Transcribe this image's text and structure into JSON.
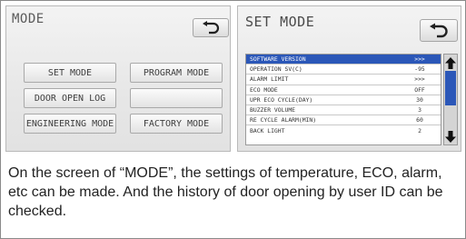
{
  "mode_screen": {
    "title": "MODE",
    "back_icon": "return-arrow-icon",
    "buttons": [
      {
        "label": "SET MODE"
      },
      {
        "label": "PROGRAM MODE"
      },
      {
        "label": "DOOR OPEN LOG"
      },
      {
        "label": ""
      },
      {
        "label": "ENGINEERING MODE"
      },
      {
        "label": "FACTORY MODE"
      }
    ]
  },
  "set_mode_screen": {
    "title": "SET MODE",
    "back_icon": "return-arrow-icon",
    "selected_color": "#2b57b8",
    "rows": [
      {
        "label": "SOFTWARE VERSION",
        "value": ">>>"
      },
      {
        "label": "OPERATION SV(C)",
        "value": "-95"
      },
      {
        "label": "ALARM LIMIT",
        "value": ">>>"
      },
      {
        "label": "ECO MODE",
        "value": "OFF"
      },
      {
        "label": "UPR ECO CYCLE(DAY)",
        "value": "30"
      },
      {
        "label": "BUZZER VOLUME",
        "value": "3"
      },
      {
        "label": "RE CYCLE ALARM(MIN)",
        "value": "60"
      },
      {
        "label": "BACK LIGHT",
        "value": "2"
      }
    ],
    "scroll_up_icon": "arrow-up-icon",
    "scroll_down_icon": "arrow-down-icon"
  },
  "caption": "On the screen of “MODE”, the settings of temperature, ECO, alarm, etc can be made. And the history of door opening by user ID can be checked."
}
